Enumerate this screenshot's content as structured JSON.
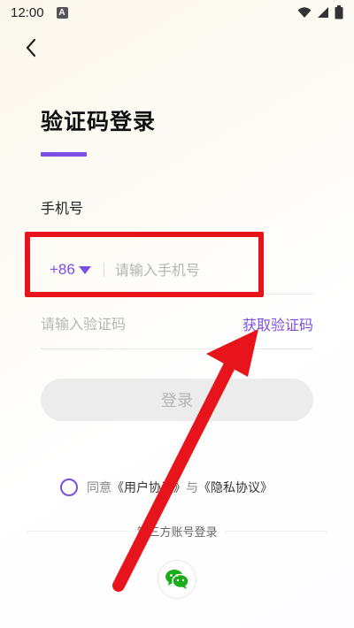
{
  "status_bar": {
    "time": "12:00",
    "notification_badge": "A"
  },
  "header": {
    "title": "验证码登录"
  },
  "phone": {
    "label": "手机号",
    "country_code": "+86",
    "placeholder": "请输入手机号"
  },
  "code": {
    "placeholder": "请输入验证码",
    "get_code_label": "获取验证码"
  },
  "login": {
    "label": "登录"
  },
  "agreement": {
    "prefix": "同意",
    "user_agreement": "《用户协议》",
    "connector": "与",
    "privacy_policy": "《隐私协议》"
  },
  "third_party": {
    "label": "第三方账号登录"
  },
  "colors": {
    "accent": "#7b4fe0",
    "annotation": "#e8141c"
  }
}
